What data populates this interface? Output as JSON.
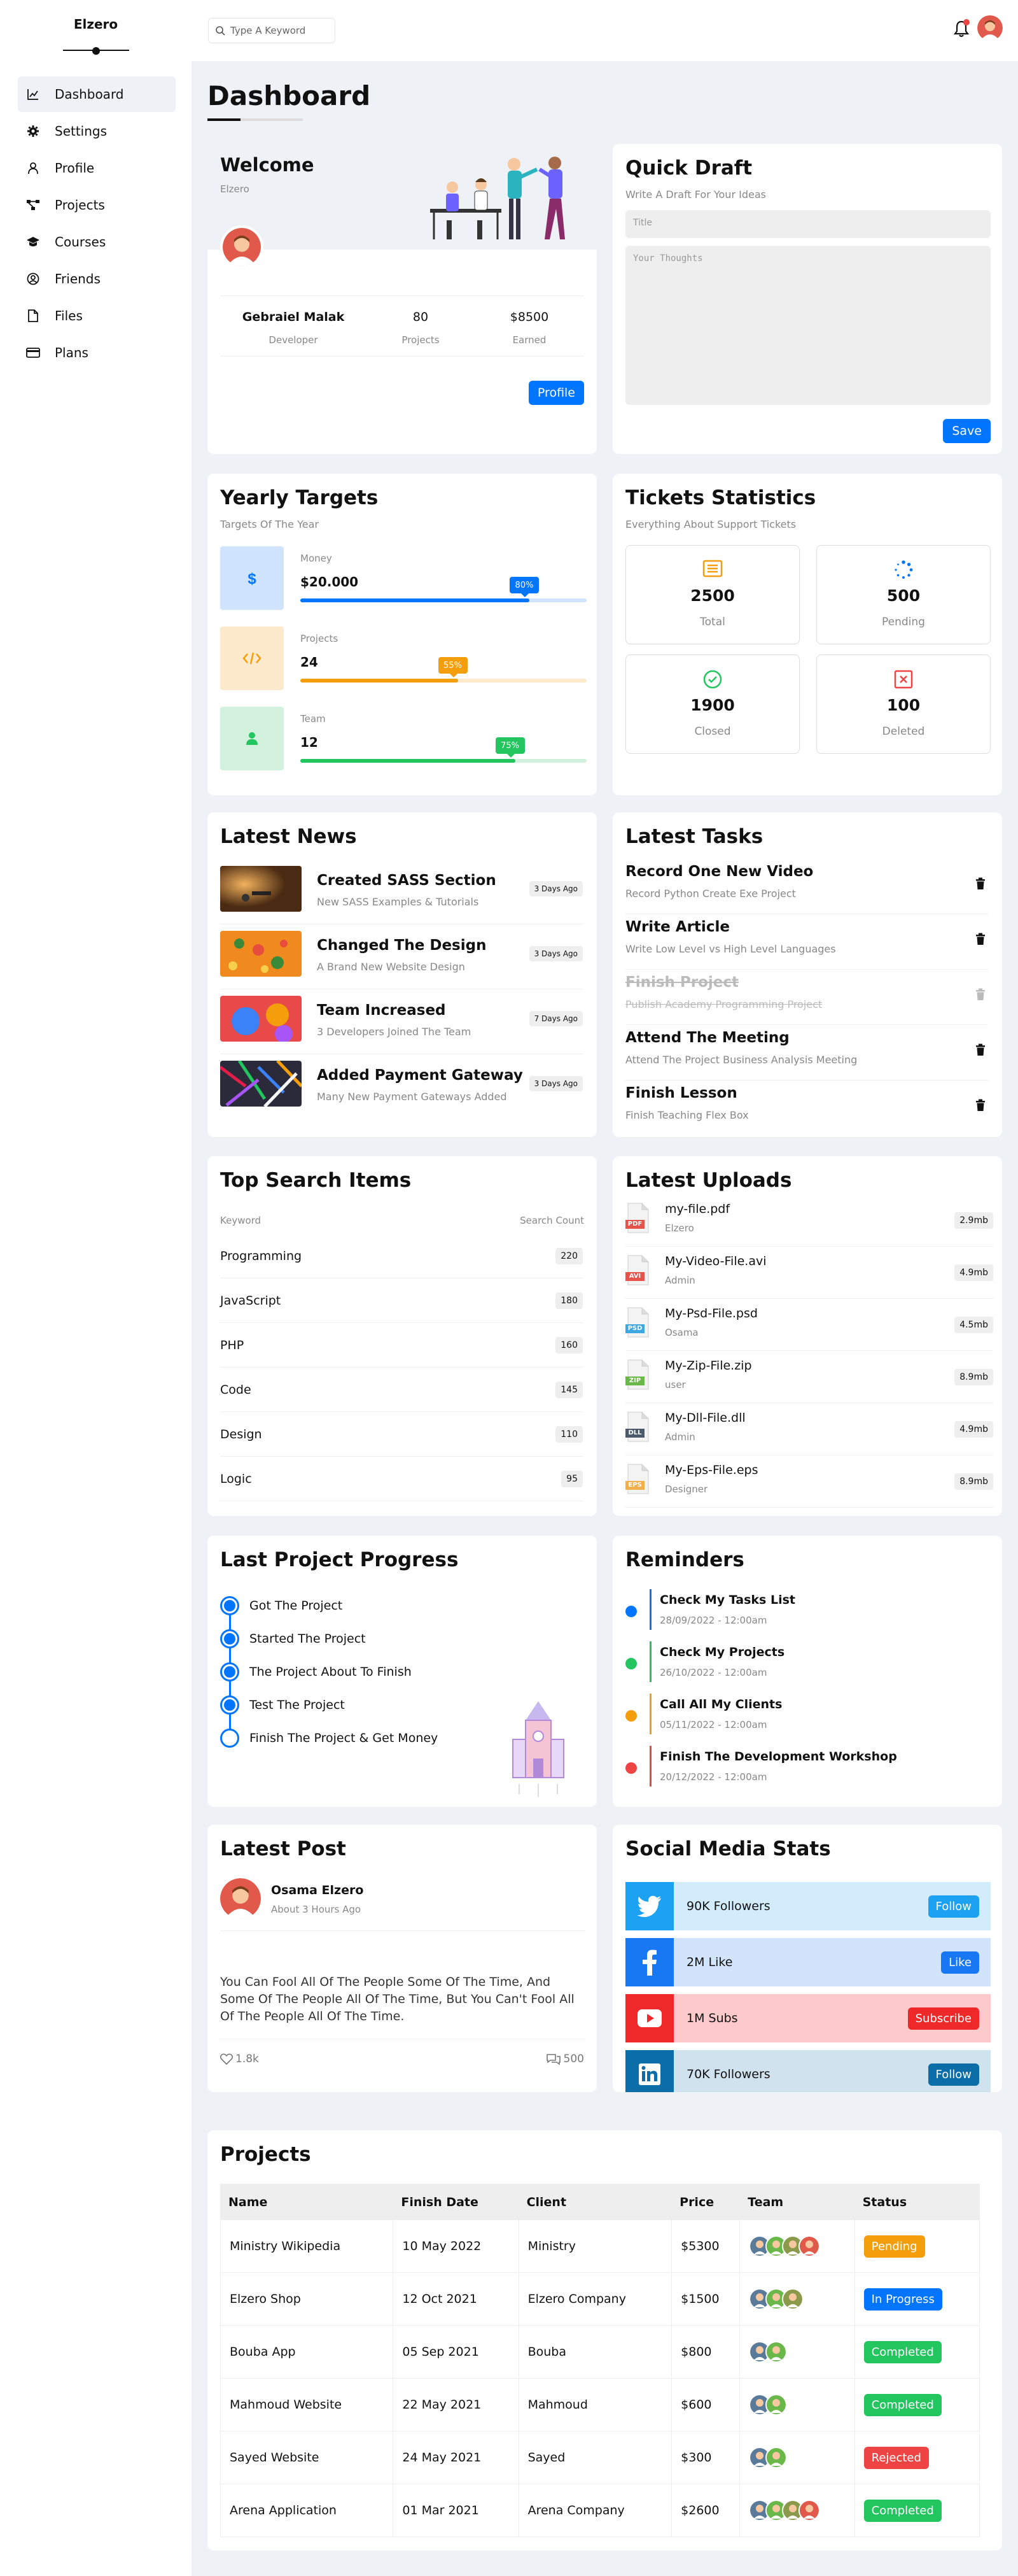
{
  "app": {
    "logo": "Elzero"
  },
  "sidebar": {
    "items": [
      {
        "label": "Dashboard",
        "icon": "chart-icon",
        "active": true
      },
      {
        "label": "Settings",
        "icon": "gear-icon"
      },
      {
        "label": "Profile",
        "icon": "user-icon"
      },
      {
        "label": "Projects",
        "icon": "diagram-icon"
      },
      {
        "label": "Courses",
        "icon": "graduation-cap-icon"
      },
      {
        "label": "Friends",
        "icon": "user-circle-icon"
      },
      {
        "label": "Files",
        "icon": "file-icon"
      },
      {
        "label": "Plans",
        "icon": "credit-card-icon"
      }
    ]
  },
  "topbar": {
    "search_placeholder": "Type A Keyword"
  },
  "page": {
    "title": "Dashboard"
  },
  "welcome": {
    "title": "Welcome",
    "subtitle": "Elzero",
    "name": "Gebraiel Malak",
    "role": "Developer",
    "projects_value": "80",
    "projects_label": "Projects",
    "earned_value": "$8500",
    "earned_label": "Earned",
    "button": "Profile"
  },
  "quick_draft": {
    "title": "Quick Draft",
    "subtitle": "Write A Draft For Your Ideas",
    "title_placeholder": "Title",
    "body_placeholder": "Your Thoughts",
    "button": "Save"
  },
  "yearly_targets": {
    "title": "Yearly Targets",
    "subtitle": "Targets Of The Year",
    "items": [
      {
        "label": "Money",
        "value": "$20.000",
        "percent": "80%",
        "fraction": 0.8,
        "color": "#0075ff",
        "light": "#d0e4ff",
        "icon": "dollar-icon"
      },
      {
        "label": "Projects",
        "value": "24",
        "percent": "55%",
        "fraction": 0.55,
        "color": "#f59e0b",
        "light": "#fde9cb",
        "icon": "code-icon"
      },
      {
        "label": "Team",
        "value": "12",
        "percent": "75%",
        "fraction": 0.75,
        "color": "#22c55e",
        "light": "#d3f2de",
        "icon": "user-icon"
      }
    ]
  },
  "tickets": {
    "title": "Tickets Statistics",
    "subtitle": "Everything About Support Tickets",
    "items": [
      {
        "value": "2500",
        "label": "Total",
        "color": "#f59e0b",
        "icon": "inbox-icon"
      },
      {
        "value": "500",
        "label": "Pending",
        "color": "#0075ff",
        "icon": "spinner-icon"
      },
      {
        "value": "1900",
        "label": "Closed",
        "color": "#22c55e",
        "icon": "check-circle-icon"
      },
      {
        "value": "100",
        "label": "Deleted",
        "color": "#ef4444",
        "icon": "x-square-icon"
      }
    ]
  },
  "latest_news": {
    "title": "Latest News",
    "items": [
      {
        "title": "Created SASS Section",
        "desc": "New SASS Examples & Tutorials",
        "ago": "3 Days Ago"
      },
      {
        "title": "Changed The Design",
        "desc": "A Brand New Website Design",
        "ago": "3 Days Ago"
      },
      {
        "title": "Team Increased",
        "desc": "3 Developers Joined The Team",
        "ago": "7 Days Ago"
      },
      {
        "title": "Added Payment Gateway",
        "desc": "Many New Payment Gateways Added",
        "ago": "3 Days Ago"
      }
    ]
  },
  "latest_tasks": {
    "title": "Latest Tasks",
    "items": [
      {
        "title": "Record One New Video",
        "desc": "Record Python Create Exe Project",
        "done": false
      },
      {
        "title": "Write Article",
        "desc": "Write Low Level vs High Level Languages",
        "done": false
      },
      {
        "title": "Finish Project",
        "desc": "Publish Academy Programming Project",
        "done": true
      },
      {
        "title": "Attend The Meeting",
        "desc": "Attend The Project Business Analysis Meeting",
        "done": false
      },
      {
        "title": "Finish Lesson",
        "desc": "Finish Teaching Flex Box",
        "done": false
      }
    ]
  },
  "top_search": {
    "title": "Top Search Items",
    "col_keyword": "Keyword",
    "col_count": "Search Count",
    "items": [
      {
        "keyword": "Programming",
        "count": "220"
      },
      {
        "keyword": "JavaScript",
        "count": "180"
      },
      {
        "keyword": "PHP",
        "count": "160"
      },
      {
        "keyword": "Code",
        "count": "145"
      },
      {
        "keyword": "Design",
        "count": "110"
      },
      {
        "keyword": "Logic",
        "count": "95"
      }
    ]
  },
  "latest_uploads": {
    "title": "Latest Uploads",
    "items": [
      {
        "name": "my-file.pdf",
        "who": "Elzero",
        "size": "2.9mb",
        "ext": "PDF",
        "color": "#e5534b"
      },
      {
        "name": "My-Video-File.avi",
        "who": "Admin",
        "size": "4.9mb",
        "ext": "AVI",
        "color": "#e5534b"
      },
      {
        "name": "My-Psd-File.psd",
        "who": "Osama",
        "size": "4.5mb",
        "ext": "PSD",
        "color": "#3ea6e0"
      },
      {
        "name": "My-Zip-File.zip",
        "who": "user",
        "size": "8.9mb",
        "ext": "ZIP",
        "color": "#6bb84a"
      },
      {
        "name": "My-Dll-File.dll",
        "who": "Admin",
        "size": "4.9mb",
        "ext": "DLL",
        "color": "#4a5a6a"
      },
      {
        "name": "My-Eps-File.eps",
        "who": "Designer",
        "size": "8.9mb",
        "ext": "EPS",
        "color": "#f2b04a"
      }
    ]
  },
  "project_progress": {
    "title": "Last Project Progress",
    "steps": [
      {
        "label": "Got The Project",
        "done": true
      },
      {
        "label": "Started The Project",
        "done": true
      },
      {
        "label": "The Project About To Finish",
        "done": true
      },
      {
        "label": "Test The Project",
        "done": true
      },
      {
        "label": "Finish The Project & Get Money",
        "done": false
      }
    ]
  },
  "reminders": {
    "title": "Reminders",
    "items": [
      {
        "title": "Check My Tasks List",
        "date": "28/09/2022 - 12:00am",
        "color": "#0075ff"
      },
      {
        "title": "Check My Projects",
        "date": "26/10/2022 - 12:00am",
        "color": "#22c55e"
      },
      {
        "title": "Call All My Clients",
        "date": "05/11/2022 - 12:00am",
        "color": "#f59e0b"
      },
      {
        "title": "Finish The Development Workshop",
        "date": "20/12/2022 - 12:00am",
        "color": "#ef4444"
      }
    ]
  },
  "latest_post": {
    "title": "Latest Post",
    "author": "Osama Elzero",
    "time": "About 3 Hours Ago",
    "body": "You Can Fool All Of The People Some Of The Time, And Some Of The People All Of The Time, But You Can't Fool All Of The People All Of The Time.",
    "likes": "1.8k",
    "comments": "500"
  },
  "social": {
    "title": "Social Media Stats",
    "items": [
      {
        "text": "90K Followers",
        "button": "Follow",
        "color": "#1da1f2",
        "light": "#d3ecfc",
        "icon": "twitter-icon"
      },
      {
        "text": "2M Like",
        "button": "Like",
        "color": "#1877f2",
        "light": "#d1e4fc",
        "icon": "facebook-icon"
      },
      {
        "text": "1M Subs",
        "button": "Subscribe",
        "color": "#ef2929",
        "light": "#fccaca",
        "icon": "youtube-icon"
      },
      {
        "text": "70K Followers",
        "button": "Follow",
        "color": "#0b6ea8",
        "light": "#cfe2ee",
        "icon": "linkedin-icon"
      }
    ]
  },
  "projects": {
    "title": "Projects",
    "headers": [
      "Name",
      "Finish Date",
      "Client",
      "Price",
      "Team",
      "Status"
    ],
    "rows": [
      {
        "name": "Ministry Wikipedia",
        "date": "10 May 2022",
        "client": "Ministry",
        "price": "$5300",
        "team": 4,
        "status": "Pending",
        "status_color": "#f59e0b"
      },
      {
        "name": "Elzero Shop",
        "date": "12 Oct 2021",
        "client": "Elzero Company",
        "price": "$1500",
        "team": 3,
        "status": "In Progress",
        "status_color": "#0075ff"
      },
      {
        "name": "Bouba App",
        "date": "05 Sep 2021",
        "client": "Bouba",
        "price": "$800",
        "team": 2,
        "status": "Completed",
        "status_color": "#22c55e"
      },
      {
        "name": "Mahmoud Website",
        "date": "22 May 2021",
        "client": "Mahmoud",
        "price": "$600",
        "team": 2,
        "status": "Completed",
        "status_color": "#22c55e"
      },
      {
        "name": "Sayed Website",
        "date": "24 May 2021",
        "client": "Sayed",
        "price": "$300",
        "team": 2,
        "status": "Rejected",
        "status_color": "#ef4444"
      },
      {
        "name": "Arena Application",
        "date": "01 Mar 2021",
        "client": "Arena Company",
        "price": "$2600",
        "team": 4,
        "status": "Completed",
        "status_color": "#22c55e"
      }
    ]
  }
}
